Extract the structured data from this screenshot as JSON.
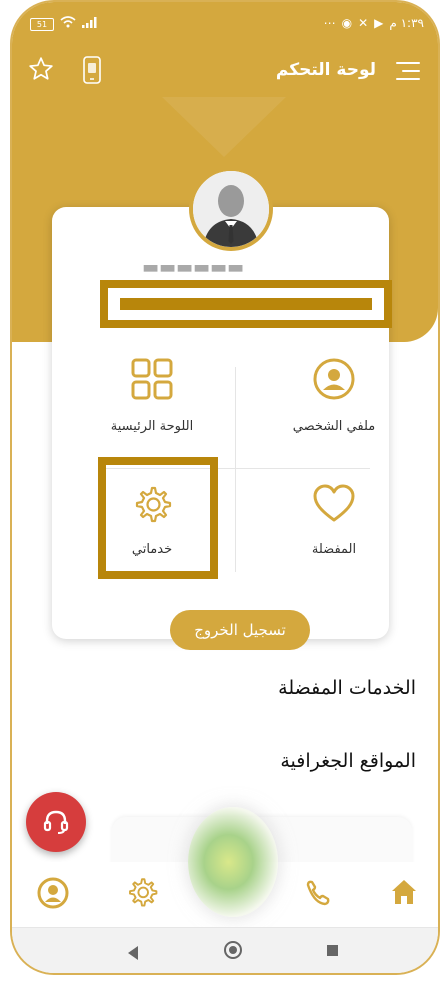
{
  "statusbar": {
    "battery": "51",
    "time": "١:٣٩ م"
  },
  "header": {
    "title": "لوحة التحكم"
  },
  "menu": {
    "dashboard_label": "اللوحة الرئيسية",
    "profile_label": "ملفي الشخصي",
    "services_label": "خدماتي",
    "favorites_label": "المفضلة"
  },
  "logout_label": "تسجيل الخروج",
  "sections": {
    "favorite_services": "الخدمات المفضلة",
    "geo_locations": "المواقع الجغرافية"
  },
  "colors": {
    "primary": "#d4a83e",
    "highlight": "#b8860b",
    "fab": "#d63d3d"
  },
  "icons": [
    "star-icon",
    "mobile-icon",
    "menu-icon",
    "grid-icon",
    "user-circle-icon",
    "gear-icon",
    "heart-icon",
    "headset-icon",
    "home-icon",
    "phone-icon"
  ]
}
